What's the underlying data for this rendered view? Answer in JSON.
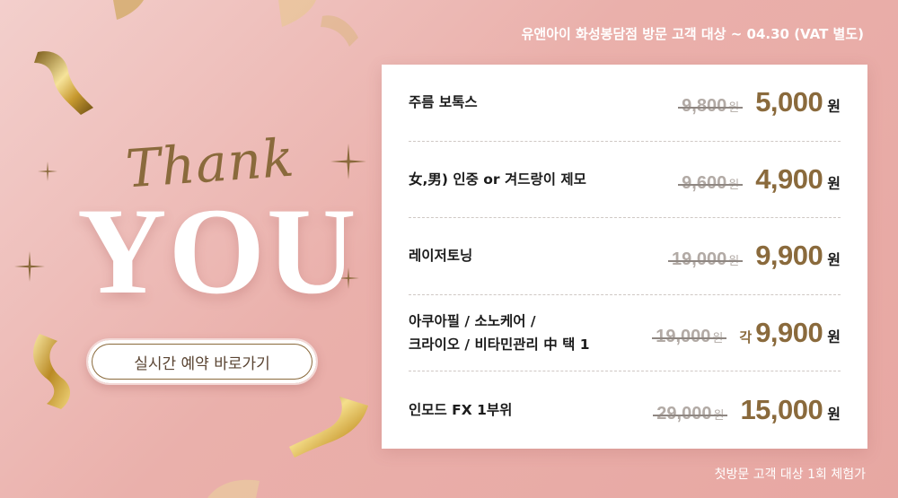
{
  "header": {
    "note": "유앤아이 화성봉담점 방문 고객 대상 ~ 04.30 (VAT 별도)"
  },
  "hero": {
    "thank": "Thank",
    "you": "YOU",
    "reserve_button": "실시간 예약 바로가기"
  },
  "prices": {
    "currency": "원",
    "each_label": "각",
    "items": [
      {
        "name": "주름 보톡스",
        "old": "9,800",
        "new": "5,000"
      },
      {
        "name": "女,男) 인중 or 겨드랑이 제모",
        "old": "9,600",
        "new": "4,900"
      },
      {
        "name": "레이저토닝",
        "old": "19,000",
        "new": "9,900"
      },
      {
        "name": "아쿠아필 / 소노케어 /\n크라이오 / 비타민관리 中 택 1",
        "old": "19,000",
        "new": "9,900"
      },
      {
        "name": "인모드 FX 1부위",
        "old": "29,000",
        "new": "15,000"
      }
    ]
  },
  "footer": {
    "note": "첫방문 고객 대상 1회 체험가"
  },
  "colors": {
    "background": "#eab0ab",
    "gold": "#8a6a3c",
    "card": "#ffffff"
  }
}
